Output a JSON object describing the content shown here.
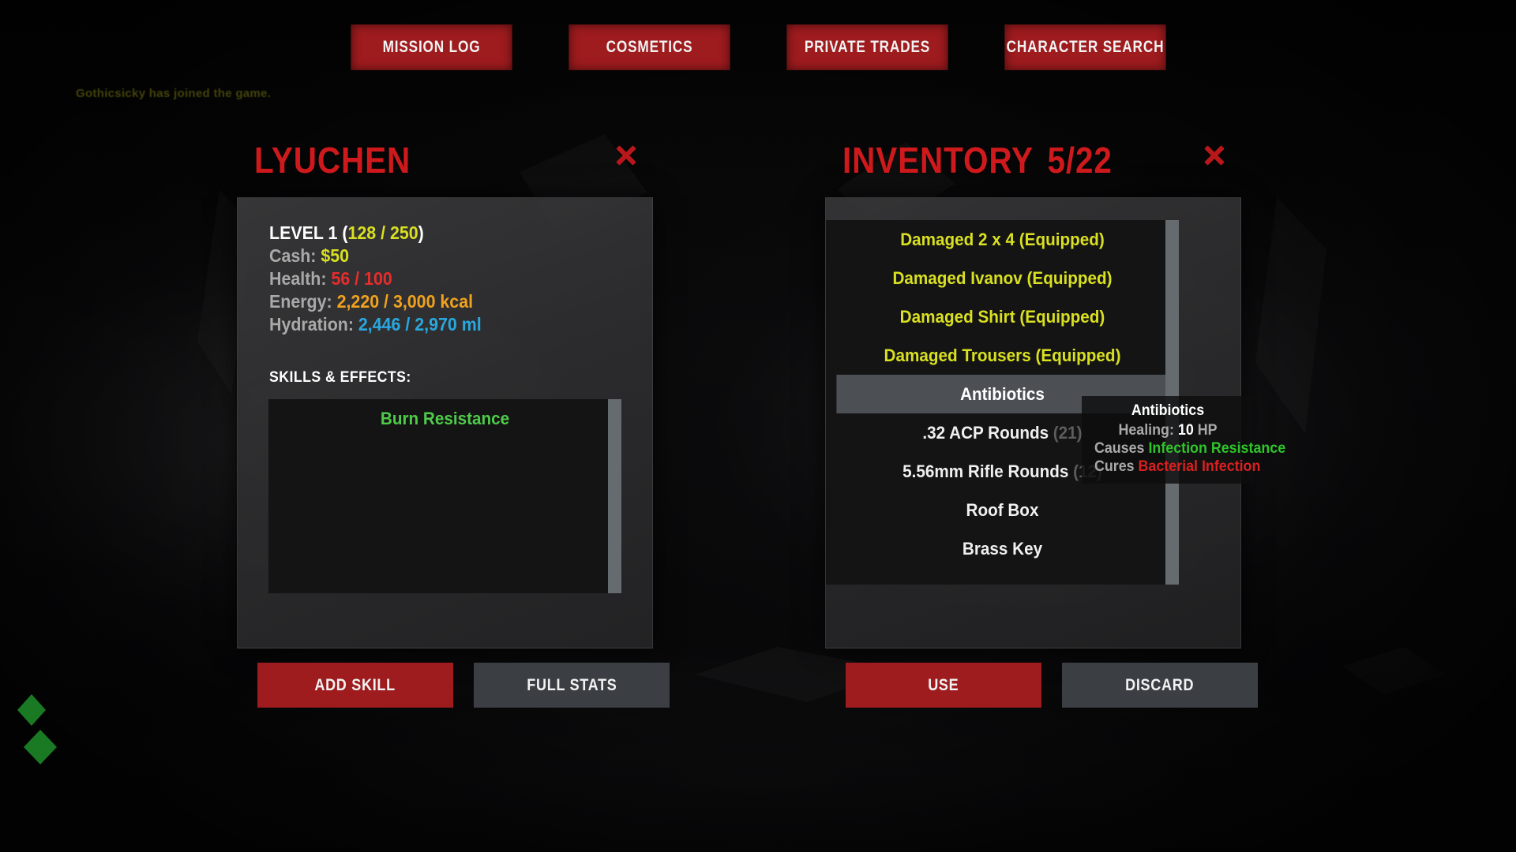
{
  "topnav": {
    "buttons": [
      {
        "label": "MISSION LOG",
        "name": "mission-log"
      },
      {
        "label": "COSMETICS",
        "name": "cosmetics"
      },
      {
        "label": "PRIVATE TRADES",
        "name": "private-trades"
      },
      {
        "label": "CHARACTER SEARCH",
        "name": "character-search"
      }
    ]
  },
  "chat": {
    "message": "Gothicsicky has joined the game."
  },
  "character": {
    "title": "LYUCHEN",
    "close_label": "×",
    "stats": {
      "level_label": "LEVEL 1",
      "xp_open": "(",
      "xp_value": "128 / 250",
      "xp_close": ")",
      "cash_label": "Cash:",
      "cash_value": "$50",
      "health_label": "Health:",
      "health_value": "56 / 100",
      "energy_label": "Energy:",
      "energy_value": "2,220 / 3,000 kcal",
      "hydration_label": "Hydration:",
      "hydration_value": "2,446 / 2,970 ml"
    },
    "skills_heading": "SKILLS & EFFECTS:",
    "skills": [
      {
        "label": "Burn Resistance"
      }
    ],
    "actions": [
      {
        "label": "ADD SKILL",
        "name": "add-skill",
        "style": "primary"
      },
      {
        "label": "FULL STATS",
        "name": "full-stats",
        "style": "secondary"
      }
    ]
  },
  "inventory": {
    "title": "INVENTORY",
    "count": "5/22",
    "close_label": "×",
    "items": [
      {
        "label": "Damaged 2 x 4 (Equipped)",
        "qty": "",
        "state": "equipped"
      },
      {
        "label": "Damaged Ivanov (Equipped)",
        "qty": "",
        "state": "equipped"
      },
      {
        "label": "Damaged Shirt (Equipped)",
        "qty": "",
        "state": "equipped"
      },
      {
        "label": "Damaged Trousers (Equipped)",
        "qty": "",
        "state": "equipped"
      },
      {
        "label": "Antibiotics",
        "qty": "",
        "state": "selected"
      },
      {
        "label": ".32 ACP Rounds",
        "qty": "(21)",
        "state": "normal"
      },
      {
        "label": "5.56mm Rifle Rounds",
        "qty": "(12)",
        "state": "normal"
      },
      {
        "label": "Roof Box",
        "qty": "",
        "state": "normal"
      },
      {
        "label": "Brass Key",
        "qty": "",
        "state": "normal"
      }
    ],
    "actions": [
      {
        "label": "USE",
        "name": "use",
        "style": "primary"
      },
      {
        "label": "DISCARD",
        "name": "discard",
        "style": "secondary"
      }
    ]
  },
  "tooltip": {
    "title": "Antibiotics",
    "healing_label": "Healing:",
    "healing_value": "10",
    "healing_unit": "HP",
    "causes_label": "Causes",
    "causes_value": "Infection Resistance",
    "cures_label": "Cures",
    "cures_value": "Bacterial Infection"
  },
  "colors": {
    "accent_red": "#9e1b1e",
    "title_red": "#cf1a1d",
    "xp_yellow": "#d9e021",
    "health_red": "#e82c2c",
    "energy_orange": "#f0a21e",
    "hydration_blue": "#29a8e0",
    "skill_green": "#4fcb4a",
    "equipped_yellow": "#d9e021",
    "panel_gray": "#3a3a3c",
    "list_black": "#141414",
    "selected_gray": "#4c5055"
  }
}
